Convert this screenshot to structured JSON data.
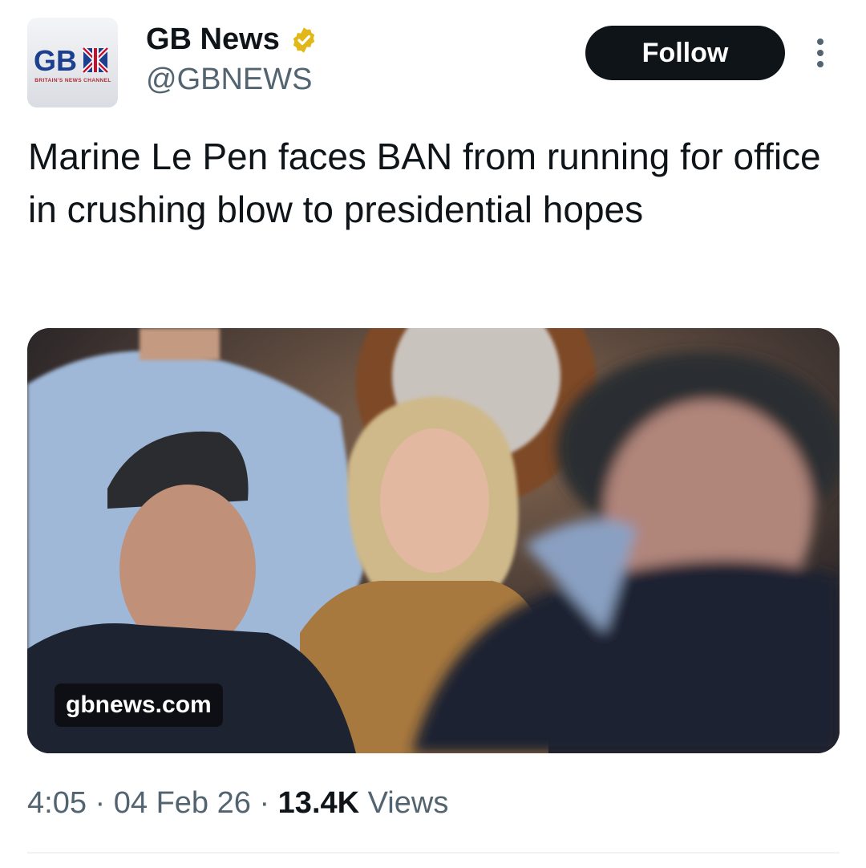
{
  "author": {
    "avatar_logo": "GBN",
    "avatar_tagline": "BRITAIN'S NEWS CHANNEL",
    "display_name": "GB News",
    "verified_icon": "verified-gold-badge-icon",
    "handle": "@GBNEWS"
  },
  "actions": {
    "follow_label": "Follow",
    "more_icon": "more-vertical-icon"
  },
  "tweet": {
    "text": "Marine Le Pen faces BAN from running for office in crushing blow to presidential hopes",
    "media_source_label": "gbnews.com"
  },
  "meta": {
    "time": "4:05",
    "separator": " · ",
    "date": "04 Feb 26",
    "views_count": "13.4K",
    "views_label": " Views"
  },
  "colors": {
    "follow_bg": "#0f1419",
    "secondary_text": "#536471",
    "verified_gold": "#e2b719"
  }
}
